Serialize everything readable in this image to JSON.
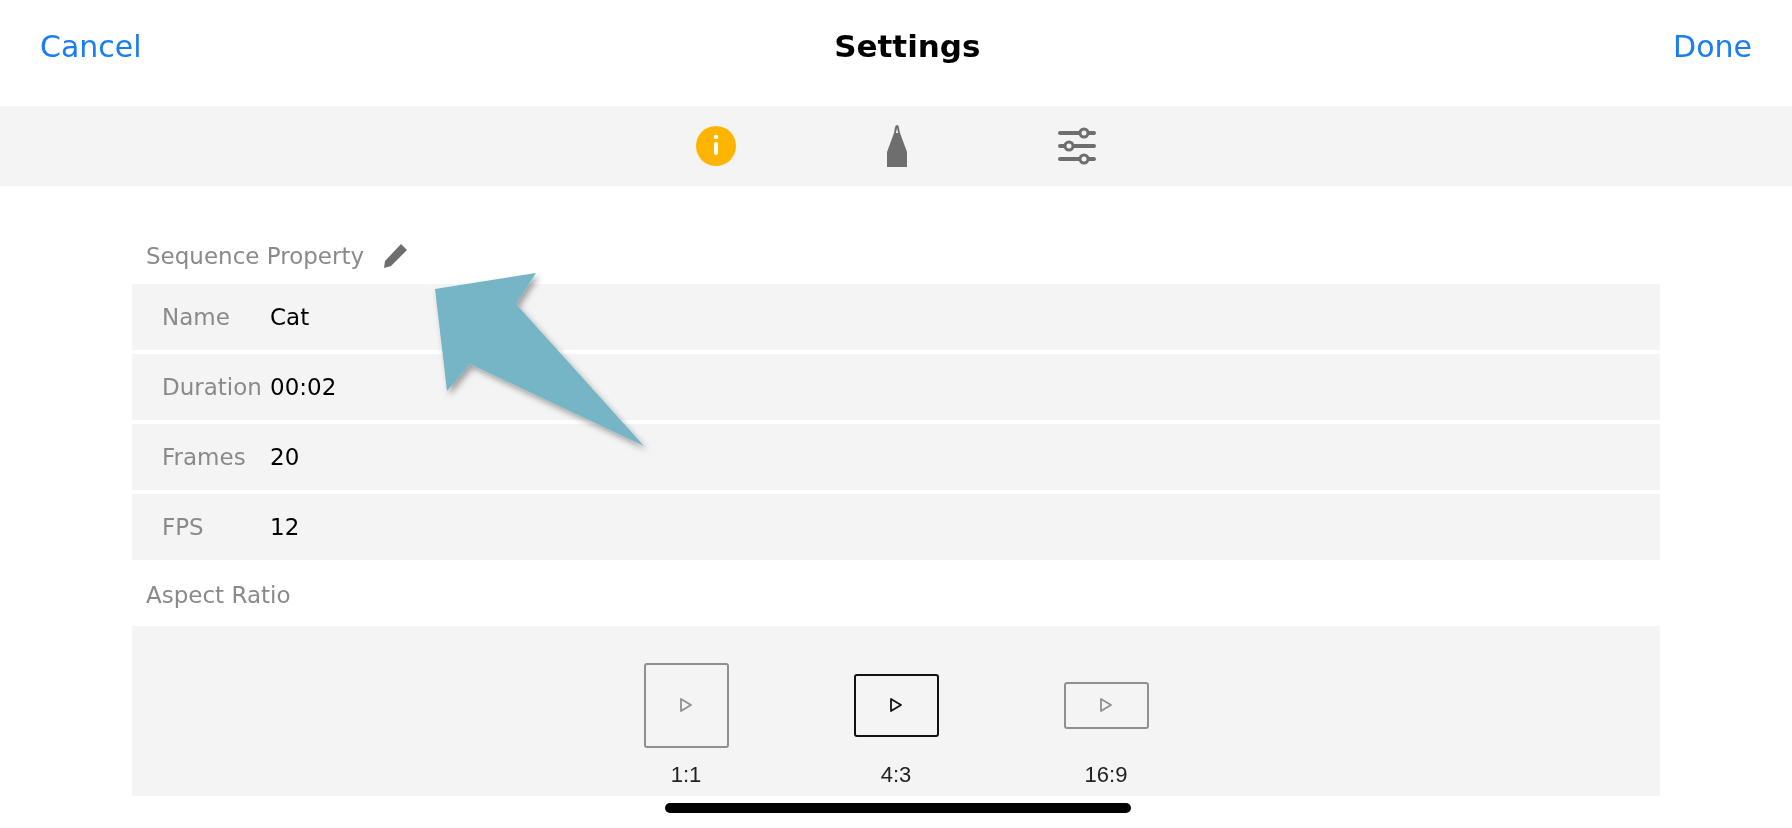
{
  "nav": {
    "cancel": "Cancel",
    "title": "Settings",
    "done": "Done"
  },
  "tabs": [
    {
      "kind": "info",
      "selected": true
    },
    {
      "kind": "pen",
      "selected": false
    },
    {
      "kind": "sliders",
      "selected": false
    }
  ],
  "sequence": {
    "header": "Sequence Property",
    "rows": [
      {
        "label": "Name",
        "value": "Cat"
      },
      {
        "label": "Duration",
        "value": "00:02"
      },
      {
        "label": "Frames",
        "value": "20"
      },
      {
        "label": "FPS",
        "value": "12"
      }
    ]
  },
  "aspect": {
    "header": "Aspect Ratio",
    "options": [
      {
        "label": "1:1",
        "kind": "square",
        "selected": false
      },
      {
        "label": "4:3",
        "kind": "standard",
        "selected": true
      },
      {
        "label": "16:9",
        "kind": "wide",
        "selected": false
      }
    ]
  }
}
